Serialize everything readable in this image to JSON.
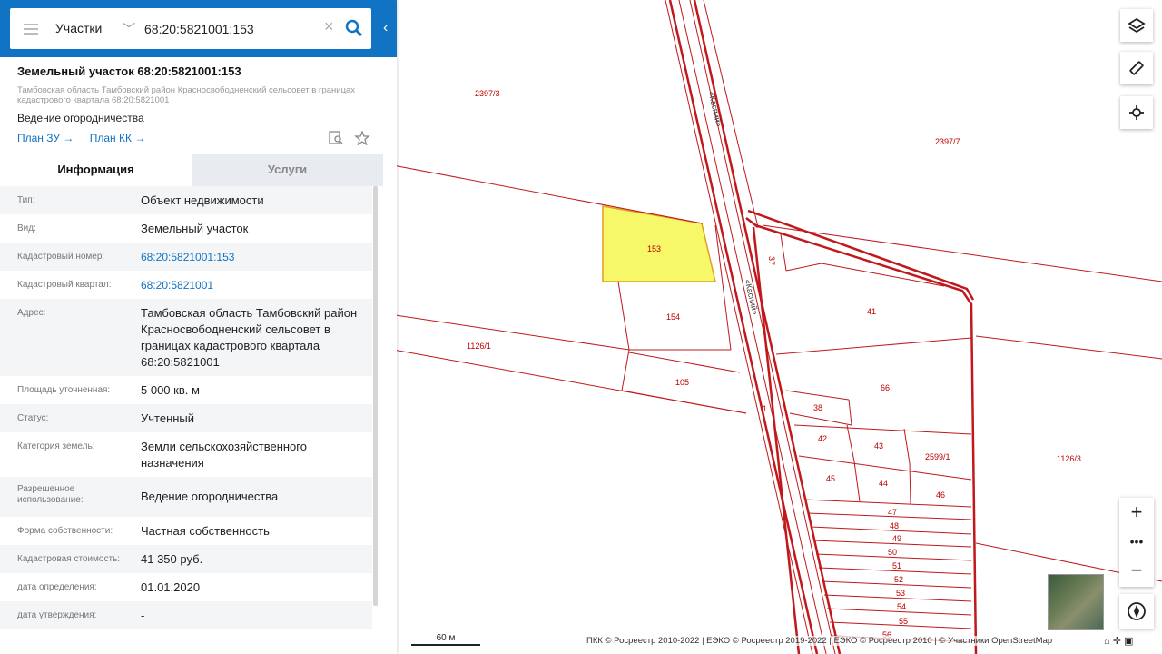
{
  "search": {
    "layer": "Участки",
    "query": "68:20:5821001:153"
  },
  "object": {
    "title": "Земельный участок 68:20:5821001:153",
    "address_small": "Тамбовская область Тамбовский район Красносвободненский сельсовет в границах кадастрового квартала 68:20:5821001",
    "use": "Ведение огородничества",
    "link_plan_zu": "План ЗУ →",
    "link_plan_kk": "План КК →"
  },
  "tabs": {
    "info": "Информация",
    "services": "Услуги"
  },
  "info_rows": [
    {
      "key": "Тип:",
      "value": "Объект недвижимости"
    },
    {
      "key": "Вид:",
      "value": "Земельный участок"
    },
    {
      "key": "Кадастровый номер:",
      "value": "68:20:5821001:153"
    },
    {
      "key": "Кадастровый квартал:",
      "value": "68:20:5821001"
    },
    {
      "key": "Адрес:",
      "value": "Тамбовская область Тамбовский район Красносвободненский сельсовет в границах кадастрового квартала 68:20:5821001"
    },
    {
      "key": "Площадь уточненная:",
      "value": "5 000 кв. м"
    },
    {
      "key": "Статус:",
      "value": "Учтенный"
    },
    {
      "key": "Категория земель:",
      "value": "Земли сельскохозяйственного назначения"
    },
    {
      "key": "Разрешенное использование:",
      "value": "Ведение огородничества"
    },
    {
      "key": "Форма собственности:",
      "value": "Частная собственность"
    },
    {
      "key": "Кадастровая стоимость:",
      "value": "41 350 руб."
    },
    {
      "key": "дата определения:",
      "value": "01.01.2020"
    },
    {
      "key": "дата утверждения:",
      "value": "-"
    }
  ],
  "map": {
    "parcel_labels": {
      "p2397_3": "2397/3",
      "p2397_7": "2397/7",
      "p153": "153",
      "p154": "154",
      "p105": "105",
      "p1126_1": "1126/1",
      "p1126_3": "1126/3",
      "p37": "37",
      "p41": "41",
      "p66": "66",
      "p38": "38",
      "p42": "42",
      "p43": "43",
      "p2599_1": "2599/1",
      "p45": "45",
      "p44": "44",
      "p46": "46",
      "p47": "47",
      "p48": "48",
      "p49": "49",
      "p50": "50",
      "p51": "51",
      "p52": "52",
      "p53": "53",
      "p54": "54",
      "p55": "55",
      "p56": "56",
      "p1": "1"
    },
    "road_label": "«Каспий»",
    "scale": "60 м",
    "attribution": "ПКК © Росреестр 2010-2022 | ЕЭКО © Росреестр 2019-2022 | ЕЭКО © Росреестр 2010 | © Участники OpenStreetMap",
    "highlight_color": "#f7f76a",
    "boundary_color": "#c0181b"
  }
}
